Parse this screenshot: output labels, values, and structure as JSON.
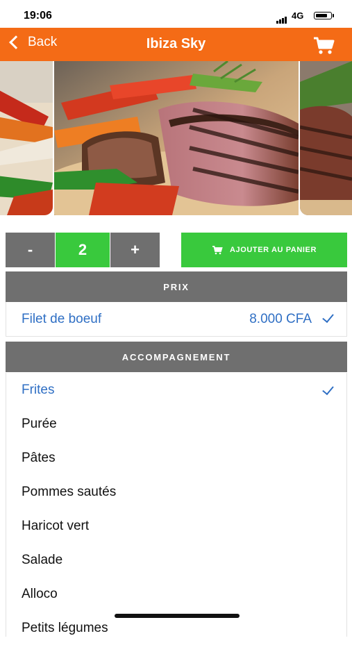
{
  "status_bar": {
    "time": "19:06",
    "network": "4G"
  },
  "nav": {
    "back_label": "Back",
    "title": "Ibiza Sky",
    "cart_icon": "cart-icon"
  },
  "carousel": {
    "images": [
      "dish-photo-left",
      "steak-photo",
      "dish-photo-right"
    ]
  },
  "stepper": {
    "minus_label": "-",
    "quantity": "2",
    "plus_label": "+"
  },
  "add_to_cart": {
    "label": "AJOUTER AU PANIER",
    "icon": "cart-icon"
  },
  "price_section": {
    "header": "PRIX",
    "item_name": "Filet de boeuf",
    "item_price": "8.000 CFA",
    "selected": true
  },
  "accompagnement": {
    "header": "ACCOMPAGNEMENT",
    "options": [
      {
        "label": "Frites",
        "selected": true
      },
      {
        "label": "Purée",
        "selected": false
      },
      {
        "label": "Pâtes",
        "selected": false
      },
      {
        "label": "Pommes sautés",
        "selected": false
      },
      {
        "label": "Haricot vert",
        "selected": false
      },
      {
        "label": "Salade",
        "selected": false
      },
      {
        "label": "Alloco",
        "selected": false
      },
      {
        "label": "Petits légumes",
        "selected": false
      }
    ]
  },
  "colors": {
    "accent_orange": "#f46b16",
    "green": "#39c93d",
    "gray_header": "#6f6f6f",
    "link_blue": "#2f6fc4"
  }
}
